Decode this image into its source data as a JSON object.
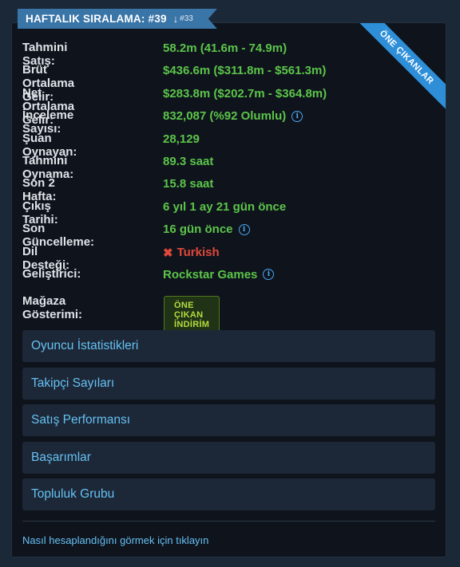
{
  "rank": {
    "title": "HAFTALIK SIRALAMA: #39",
    "arrow": "↓",
    "previous": "#33"
  },
  "ribbon": {
    "label": "ÖNE ÇIKANLAR"
  },
  "stats": [
    {
      "label": "Tahmini Satış:",
      "value": "58.2m (41.6m - 74.9m)"
    },
    {
      "label": "Brüt Ortalama Gelir:",
      "value": "$436.6m ($311.8m - $561.3m)"
    },
    {
      "label": "Net Ortalama Gelir:",
      "value": "$283.8m ($202.7m - $364.8m)"
    },
    {
      "label": "İnceleme Sayısı:",
      "value": "832,087 (%92 Olumlu)"
    },
    {
      "label": "Şuan Oynayan:",
      "value": "28,129"
    },
    {
      "label": "Tahmini Oynama:",
      "value": "89.3 saat"
    },
    {
      "label": "Son 2 Hafta:",
      "value": "15.8 saat"
    },
    {
      "label": "Çıkış Tarihi:",
      "value": "6 yıl 1 ay 21 gün önce"
    },
    {
      "label": "Son Güncelleme:",
      "value": "16 gün önce"
    },
    {
      "label": "Dil Desteği:",
      "value": "Turkish"
    },
    {
      "label": "Geliştirici:",
      "value": "Rockstar Games"
    }
  ],
  "store": {
    "label": "Mağaza Gösterimi:",
    "badge": "ÖNE ÇIKAN İNDİRİM"
  },
  "menu": [
    "Oyuncu İstatistikleri",
    "Takipçi Sayıları",
    "Satış Performansı",
    "Başarımlar",
    "Topluluk Grubu"
  ],
  "footer": {
    "link": "Nasıl hesaplandığını görmek için tıklayın"
  },
  "icons": {
    "info": "info-icon",
    "language_unsupported": "x-icon"
  },
  "colors": {
    "positive": "#5cc44a",
    "negative": "#e0483a",
    "link": "#66c0f4",
    "accent": "#3a75a8",
    "ribbon": "#2e8fd8",
    "badge_text": "#b3dc3e"
  }
}
